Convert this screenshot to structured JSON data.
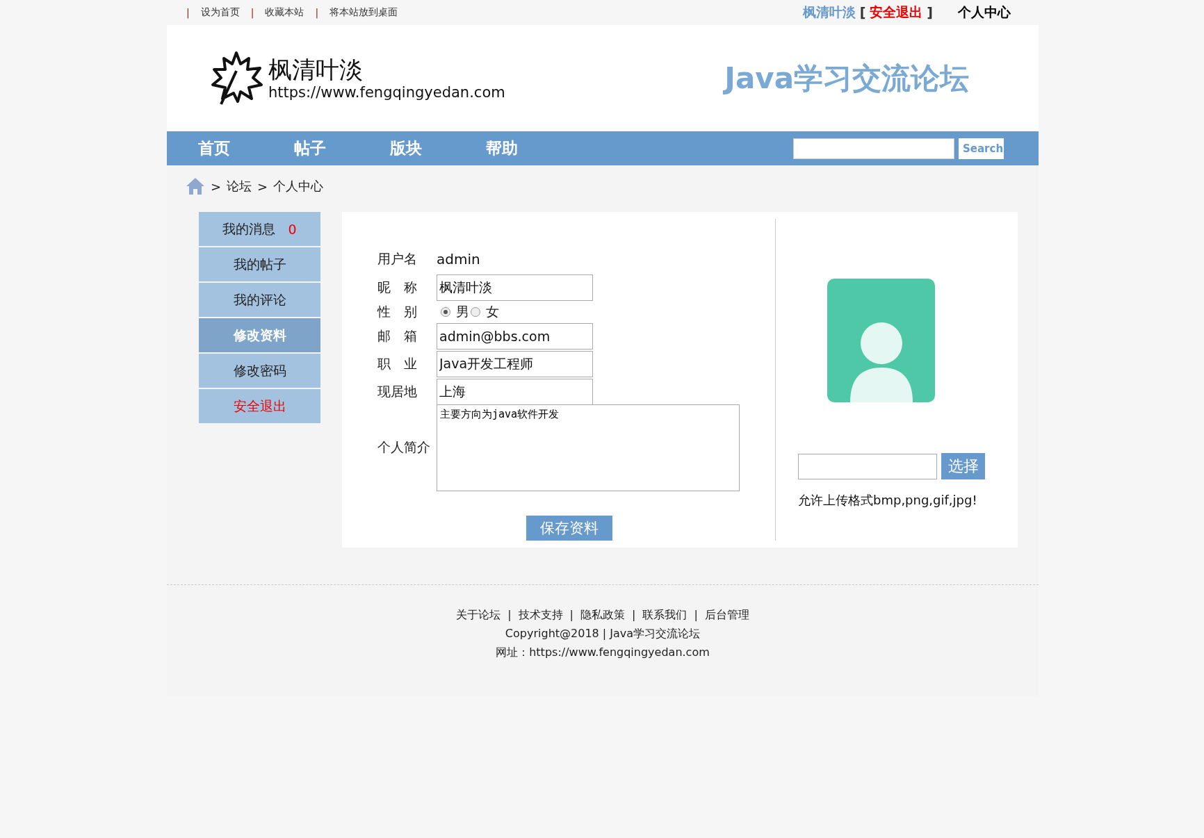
{
  "top_bar": {
    "separator": "|",
    "links": [
      "设为首页",
      "收藏本站",
      "将本站放到桌面"
    ],
    "user": {
      "name": "枫清叶淡",
      "open_bracket": "[",
      "logout": "安全退出",
      "close_bracket": "]",
      "center": "个人中心"
    }
  },
  "header": {
    "logo_name": "枫清叶淡",
    "logo_url": "https://www.fengqingyedan.com",
    "banner_title": "Java学习交流论坛"
  },
  "nav": {
    "items": [
      "首页",
      "帖子",
      "版块",
      "帮助"
    ],
    "search_button": "Search"
  },
  "breadcrumb": {
    "separator": ">",
    "items": [
      "论坛",
      "个人中心"
    ]
  },
  "sidebar": {
    "items": [
      {
        "label": "我的消息",
        "badge": "0",
        "selected": false,
        "kind": "normal"
      },
      {
        "label": "我的帖子",
        "selected": false,
        "kind": "normal"
      },
      {
        "label": "我的评论",
        "selected": false,
        "kind": "normal"
      },
      {
        "label": "修改资料",
        "selected": true,
        "kind": "normal"
      },
      {
        "label": "修改密码",
        "selected": false,
        "kind": "normal"
      },
      {
        "label": "安全退出",
        "selected": false,
        "kind": "danger"
      }
    ]
  },
  "form": {
    "fields": [
      {
        "kind": "static",
        "label": "用户名",
        "value": "admin"
      },
      {
        "kind": "input",
        "label": "昵　称",
        "value": "枫清叶淡"
      },
      {
        "kind": "radio",
        "label": "性　别",
        "options": [
          {
            "label": "男",
            "selected": true
          },
          {
            "label": "女",
            "selected": false
          }
        ]
      },
      {
        "kind": "input",
        "label": "邮　箱",
        "value": "admin@bbs.com"
      },
      {
        "kind": "input",
        "label": "职　业",
        "value": "Java开发工程师"
      },
      {
        "kind": "input",
        "label": "现居地",
        "value": "上海"
      },
      {
        "kind": "textarea",
        "label": "个人简介",
        "value": "主要方向为java软件开发"
      }
    ],
    "save_button": "保存资料"
  },
  "upload": {
    "button": "选择",
    "hint": "允许上传格式bmp,png,gif,jpg!"
  },
  "footer": {
    "separator": "|",
    "links": [
      "关于论坛",
      "技术支持",
      "隐私政策",
      "联系我们",
      "后台管理"
    ],
    "copyright": "Copyright@2018 | Java学习交流论坛",
    "address": "网址：https://www.fengqingyedan.com"
  }
}
